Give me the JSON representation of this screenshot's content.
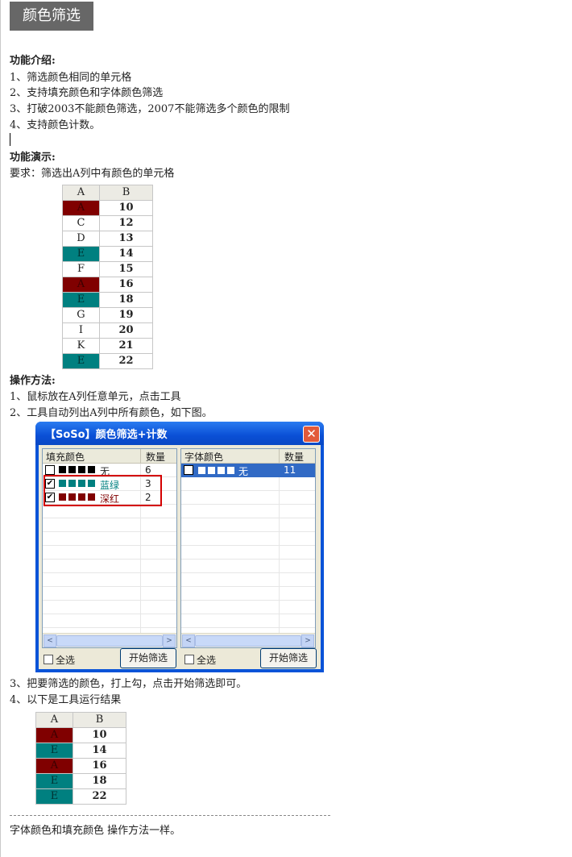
{
  "page_title": "颜色筛选",
  "intro": {
    "heading": "功能介绍:",
    "items": [
      "1、筛选颜色相同的单元格",
      "2、支持填充颜色和字体颜色筛选",
      "3、打破2003不能颜色筛选，2007不能筛选多个颜色的限制",
      "4、支持颜色计数。"
    ]
  },
  "demo": {
    "heading": "功能演示:",
    "requirement": "要求：筛选出A列中有颜色的单元格",
    "table": {
      "headers": [
        "A",
        "B"
      ],
      "rows": [
        {
          "a": "A",
          "b": "10",
          "fill": "red"
        },
        {
          "a": "C",
          "b": "12",
          "fill": ""
        },
        {
          "a": "D",
          "b": "13",
          "fill": ""
        },
        {
          "a": "E",
          "b": "14",
          "fill": "teal"
        },
        {
          "a": "F",
          "b": "15",
          "fill": ""
        },
        {
          "a": "A",
          "b": "16",
          "fill": "red"
        },
        {
          "a": "E",
          "b": "18",
          "fill": "teal"
        },
        {
          "a": "G",
          "b": "19",
          "fill": ""
        },
        {
          "a": "I",
          "b": "20",
          "fill": ""
        },
        {
          "a": "K",
          "b": "21",
          "fill": ""
        },
        {
          "a": "E",
          "b": "22",
          "fill": "teal"
        }
      ]
    }
  },
  "method": {
    "heading": "操作方法:",
    "step1": "1、鼠标放在A列任意单元，点击工具",
    "step2": "2、工具自动列出A列中所有颜色，如下图。",
    "step3": "3、把要筛选的颜色，打上勾，点击开始筛选即可。",
    "step4": "4、以下是工具运行结果"
  },
  "dialog": {
    "title": "【SoSo】颜色筛选+计数",
    "close": "✕",
    "fill_header": "填充颜色",
    "font_header": "字体颜色",
    "count_header": "数量",
    "fill_rows": [
      {
        "checked": false,
        "label": "无",
        "count": "6",
        "swatch": "#000000"
      },
      {
        "checked": true,
        "label": "蓝绿",
        "count": "3",
        "swatch": "#008080"
      },
      {
        "checked": true,
        "label": "深红",
        "count": "2",
        "swatch": "#800000"
      }
    ],
    "font_rows": [
      {
        "checked": false,
        "label": "无",
        "count": "11",
        "swatch": "#ffffff"
      }
    ],
    "select_all": "全选",
    "start_button": "开始筛选",
    "scroll_left": "<",
    "scroll_right": ">"
  },
  "result_table": {
    "headers": [
      "A",
      "B"
    ],
    "rows": [
      {
        "a": "A",
        "b": "10",
        "fill": "red"
      },
      {
        "a": "E",
        "b": "14",
        "fill": "teal"
      },
      {
        "a": "A",
        "b": "16",
        "fill": "red"
      },
      {
        "a": "E",
        "b": "18",
        "fill": "teal"
      },
      {
        "a": "E",
        "b": "22",
        "fill": "teal"
      }
    ]
  },
  "footer_note": "字体颜色和填充颜色 操作方法一样。"
}
